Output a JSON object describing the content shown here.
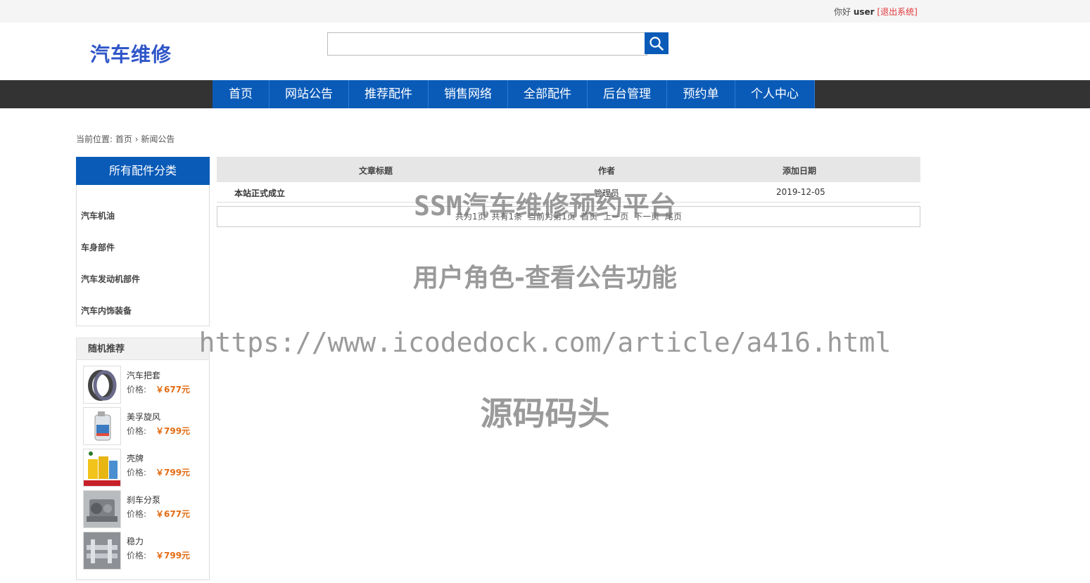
{
  "topbar": {
    "greeting": "你好",
    "username": "user",
    "logout": "[退出系统]"
  },
  "logo": "汽车维修",
  "search": {
    "placeholder": ""
  },
  "nav": [
    "首页",
    "网站公告",
    "推荐配件",
    "销售网络",
    "全部配件",
    "后台管理",
    "预约单",
    "个人中心"
  ],
  "breadcrumb": {
    "prefix": "当前位置:",
    "home": "首页",
    "sep": "›",
    "current": "新闻公告"
  },
  "sidebar": {
    "title": "所有配件分类",
    "categories": [
      "汽车机油",
      "车身部件",
      "汽车发动机部件",
      "汽车内饰装备"
    ]
  },
  "recommend": {
    "title": "随机推荐",
    "price_label": "价格:",
    "items": [
      {
        "name": "汽车把套",
        "price": "￥677元"
      },
      {
        "name": "美孚旋风",
        "price": "￥799元"
      },
      {
        "name": "壳牌",
        "price": "￥799元"
      },
      {
        "name": "刹车分泵",
        "price": "￥677元"
      },
      {
        "name": "稳力",
        "price": "￥799元"
      }
    ]
  },
  "table": {
    "headers": [
      "文章标题",
      "作者",
      "添加日期"
    ],
    "rows": [
      {
        "title": "本站正式成立",
        "author": "管理员",
        "date": "2019-12-05"
      }
    ]
  },
  "pager": [
    "共为1页",
    "共有1条",
    "当前为第1页",
    "首页",
    "上一页",
    "下一页",
    "尾页"
  ],
  "watermark": {
    "line1": "SSM汽车维修预约平台",
    "line2": "用户角色-查看公告功能",
    "line3": "https://www.icodedock.com/article/a416.html",
    "line4": "源码码头"
  },
  "colors": {
    "primary": "#0a5bb8",
    "nav_band": "#333333",
    "price": "#e36b12",
    "logo": "#2f56c9",
    "logout": "#e4393c"
  }
}
